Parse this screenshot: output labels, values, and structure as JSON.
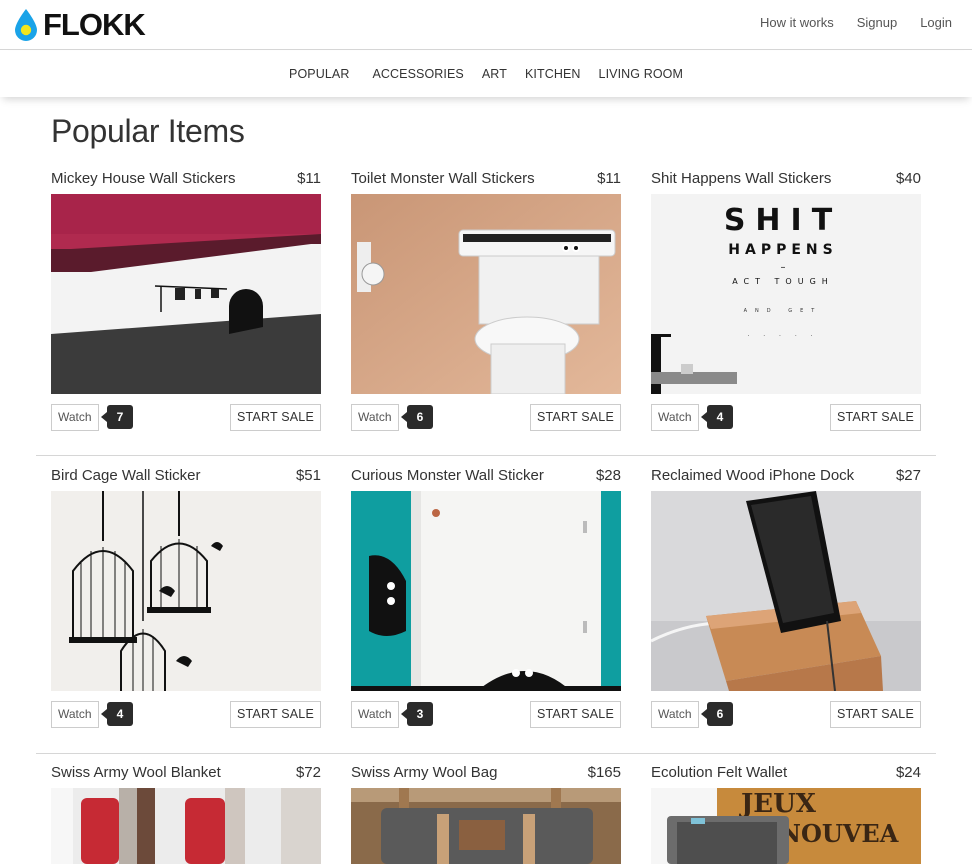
{
  "brand": {
    "name": "FLOKK",
    "drop_color": "#1aa3e8",
    "dot_color": "#f2e61c"
  },
  "header": {
    "links": [
      "How it works",
      "Signup",
      "Login"
    ]
  },
  "categories": [
    "POPULAR",
    "ACCESSORIES",
    "ART",
    "KITCHEN",
    "LIVING ROOM"
  ],
  "page": {
    "title": "Popular Items"
  },
  "actions": {
    "watch_label": "Watch",
    "sale_label": "START SALE"
  },
  "products": [
    {
      "name": "Mickey House Wall Stickers",
      "price": "$11",
      "watchers": "7"
    },
    {
      "name": "Toilet Monster Wall Stickers",
      "price": "$11",
      "watchers": "6"
    },
    {
      "name": "Shit Happens Wall Stickers",
      "price": "$40",
      "watchers": "4",
      "image_text": [
        "SHIT",
        "HAPPENS",
        "–",
        "ACT TOUGH",
        "AND GET",
        ". . . . ."
      ]
    },
    {
      "name": "Bird Cage Wall Sticker",
      "price": "$51",
      "watchers": "4"
    },
    {
      "name": "Curious Monster Wall Sticker",
      "price": "$28",
      "watchers": "3"
    },
    {
      "name": "Reclaimed Wood iPhone Dock",
      "price": "$27",
      "watchers": "6"
    },
    {
      "name": "Swiss Army Wool Blanket",
      "price": "$72"
    },
    {
      "name": "Swiss Army Wool Bag",
      "price": "$165"
    },
    {
      "name": "Ecolution Felt Wallet",
      "price": "$24",
      "image_text": [
        "JEUX",
        "NOUVEA"
      ]
    }
  ]
}
